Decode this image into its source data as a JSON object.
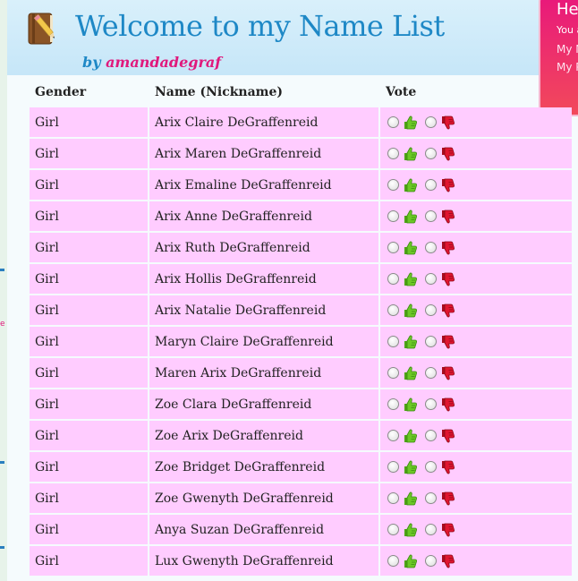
{
  "header": {
    "title": "Welcome to my Name List",
    "by_prefix": "by",
    "author": "amandadegraf"
  },
  "popup": {
    "greeting": "Hell",
    "text": "You ar",
    "link1": "My Na",
    "link2": "My Pr"
  },
  "table": {
    "headers": {
      "gender": "Gender",
      "name": "Name (Nickname)",
      "vote": "Vote"
    },
    "rows": [
      {
        "gender": "Girl",
        "name": "Arix Claire DeGraffenreid"
      },
      {
        "gender": "Girl",
        "name": "Arix Maren DeGraffenreid"
      },
      {
        "gender": "Girl",
        "name": "Arix Emaline DeGraffenreid"
      },
      {
        "gender": "Girl",
        "name": "Arix Anne DeGraffenreid"
      },
      {
        "gender": "Girl",
        "name": "Arix Ruth DeGraffenreid"
      },
      {
        "gender": "Girl",
        "name": "Arix Hollis DeGraffenreid"
      },
      {
        "gender": "Girl",
        "name": "Arix Natalie DeGraffenreid"
      },
      {
        "gender": "Girl",
        "name": "Maryn Claire DeGraffenreid"
      },
      {
        "gender": "Girl",
        "name": "Maren Arix DeGraffenreid"
      },
      {
        "gender": "Girl",
        "name": "Zoe Clara DeGraffenreid"
      },
      {
        "gender": "Girl",
        "name": "Zoe Arix DeGraffenreid"
      },
      {
        "gender": "Girl",
        "name": "Zoe Bridget DeGraffenreid"
      },
      {
        "gender": "Girl",
        "name": "Zoe Gwenyth DeGraffenreid"
      },
      {
        "gender": "Girl",
        "name": "Anya Suzan DeGraffenreid"
      },
      {
        "gender": "Girl",
        "name": "Lux Gwenyth DeGraffenreid"
      }
    ]
  },
  "colors": {
    "title": "#1e88c6",
    "author": "#e0197c",
    "row_bg": "#ffccff",
    "thumb_up": "#5fbf1f",
    "thumb_down": "#d8102a"
  },
  "icons": {
    "logo": "book-pencil-icon",
    "vote_up": "thumbs-up-icon",
    "vote_down": "thumbs-down-icon"
  }
}
